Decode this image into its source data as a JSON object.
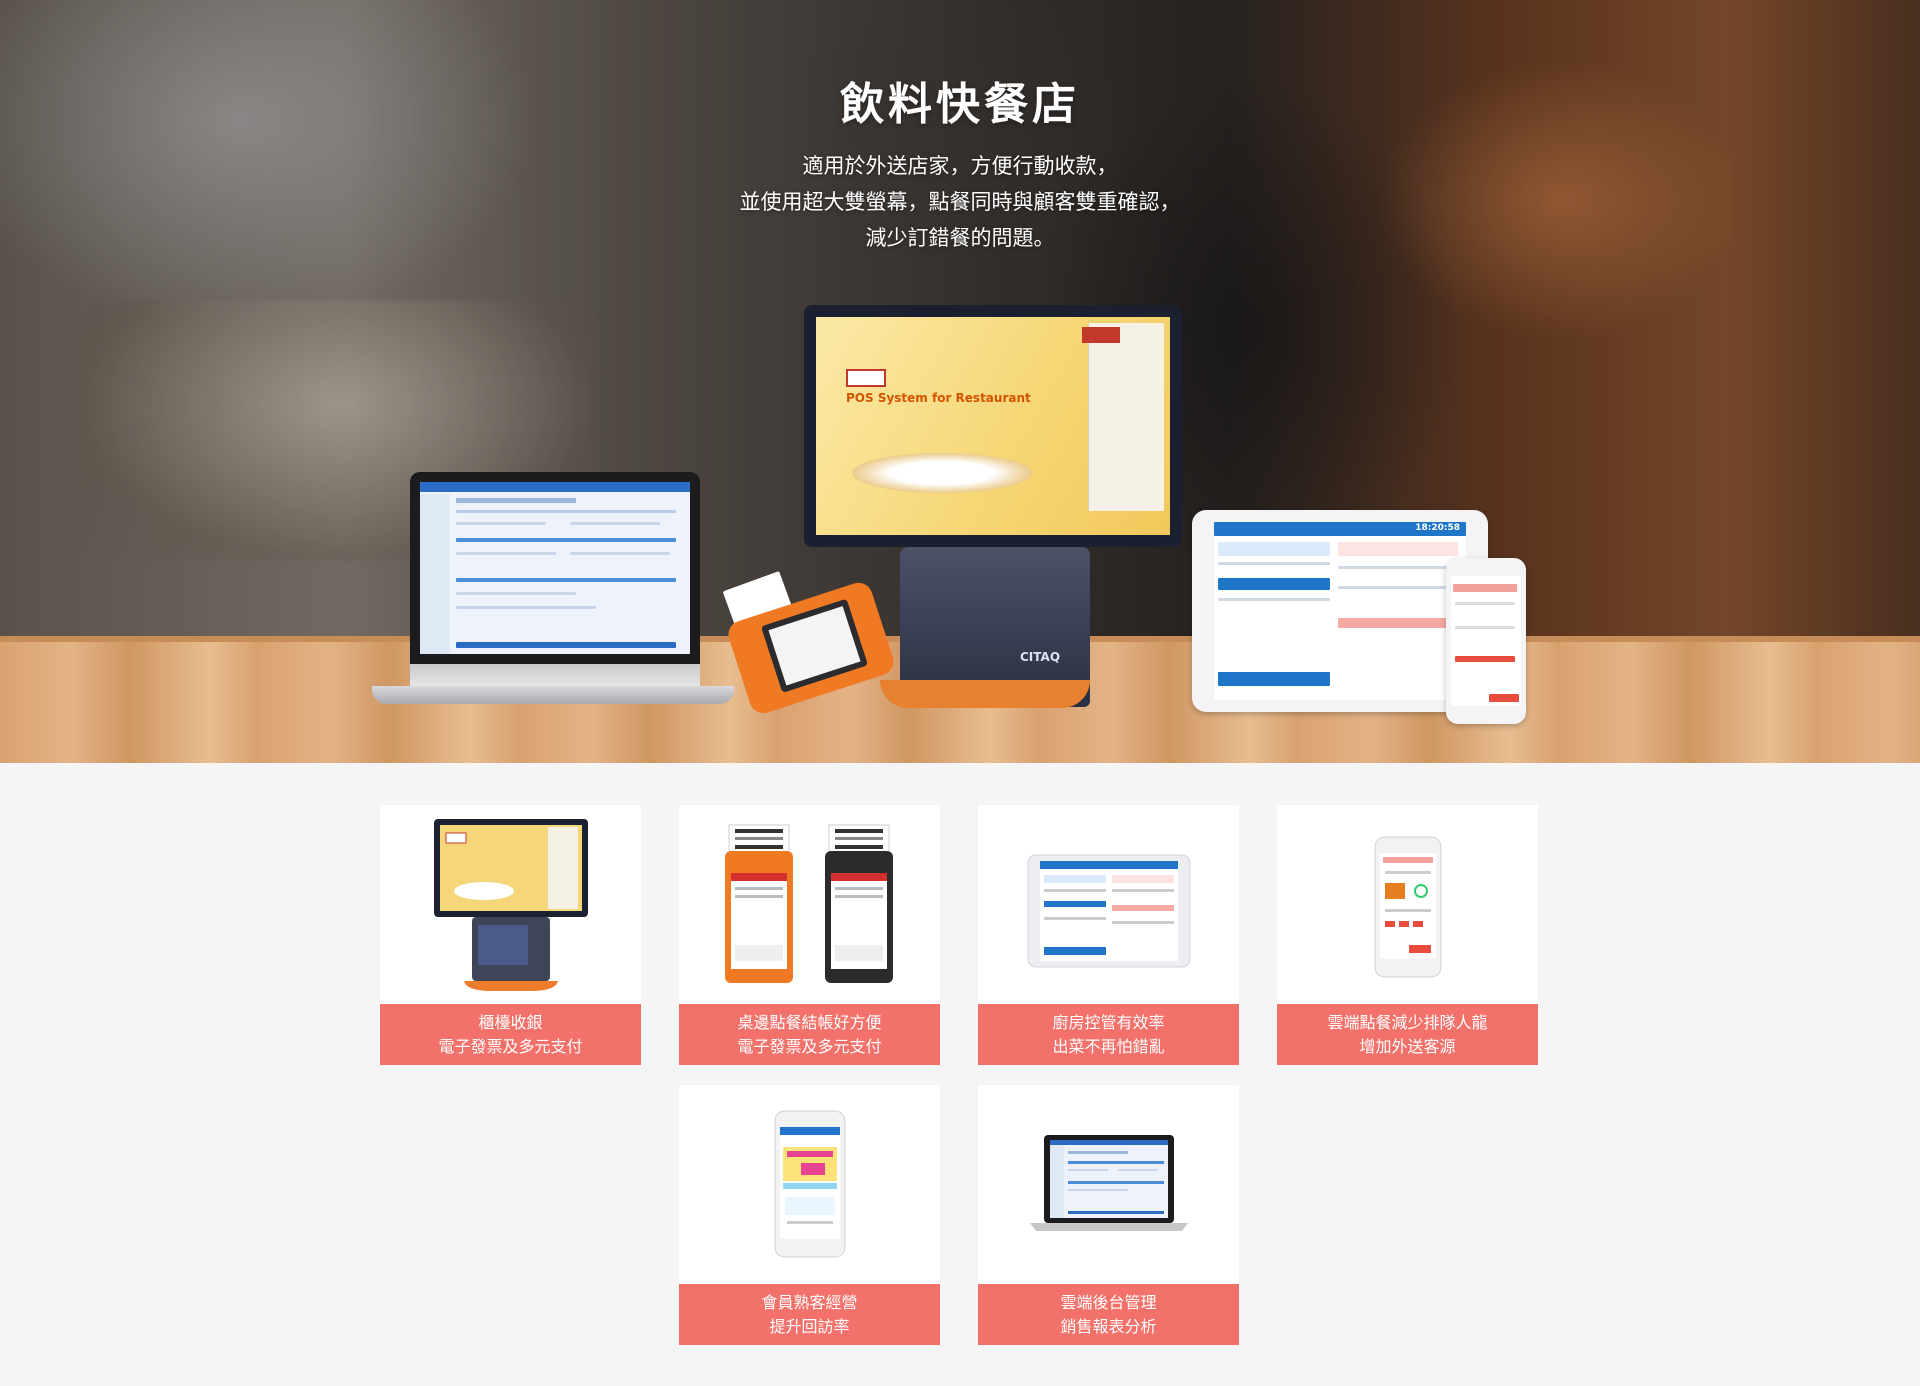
{
  "hero": {
    "title": "飲料快餐店",
    "description": [
      "適用於外送店家，方便行動收款，",
      "並使用超大雙螢幕，點餐同時與顧客雙重確認，",
      "減少訂錯餐的問題。"
    ],
    "pos_screen_text": "POS System for Restaurant",
    "pos_brand": "CITAQ",
    "tablet_time": "18:20:58"
  },
  "cards": [
    {
      "line1": "櫃檯收銀",
      "line2": "電子發票及多元支付",
      "icon": "pos-terminal-icon"
    },
    {
      "line1": "桌邊點餐結帳好方便",
      "line2": "電子發票及多元支付",
      "icon": "handheld-pos-icon"
    },
    {
      "line1": "廚房控管有效率",
      "line2": "出菜不再怕錯亂",
      "icon": "tablet-kitchen-icon"
    },
    {
      "line1": "雲端點餐減少排隊人龍",
      "line2": "增加外送客源",
      "icon": "phone-ordering-icon"
    },
    {
      "line1": "會員熟客經營",
      "line2": "提升回訪率",
      "icon": "phone-member-icon"
    },
    {
      "line1": "雲端後台管理",
      "line2": "銷售報表分析",
      "icon": "laptop-backend-icon"
    }
  ],
  "colors": {
    "accent": "#f3716b",
    "card_bg": "#ffffff",
    "page_bg": "#f5f5f5",
    "device_orange": "#f07a24"
  }
}
